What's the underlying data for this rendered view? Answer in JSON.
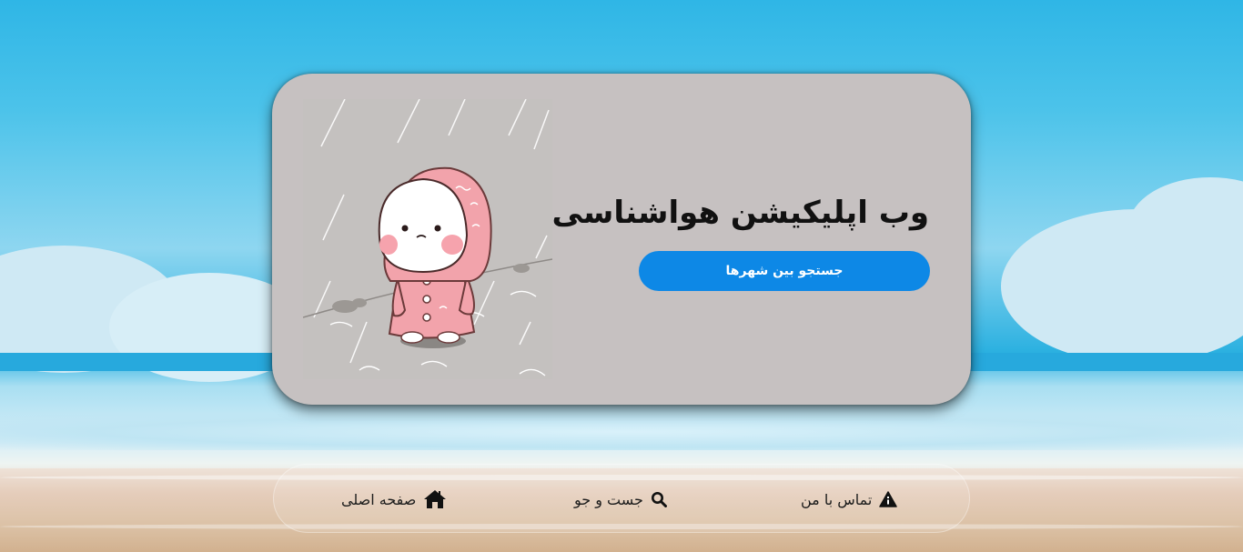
{
  "hero": {
    "title": "وب اپلیکیشن هواشناسی",
    "search_button_label": "جستجو بین شهرها"
  },
  "nav": {
    "items": [
      {
        "label": "صفحه اصلی",
        "icon": "home-icon"
      },
      {
        "label": "جست و جو",
        "icon": "search-icon"
      },
      {
        "label": "تماس با من",
        "icon": "info-triangle-icon"
      }
    ]
  },
  "colors": {
    "card_bg": "#c6c1c1",
    "button_bg": "#0d88e6",
    "sky": "#2fb6e6",
    "sea": "#27a9dd",
    "sand": "#dbc1a5"
  }
}
